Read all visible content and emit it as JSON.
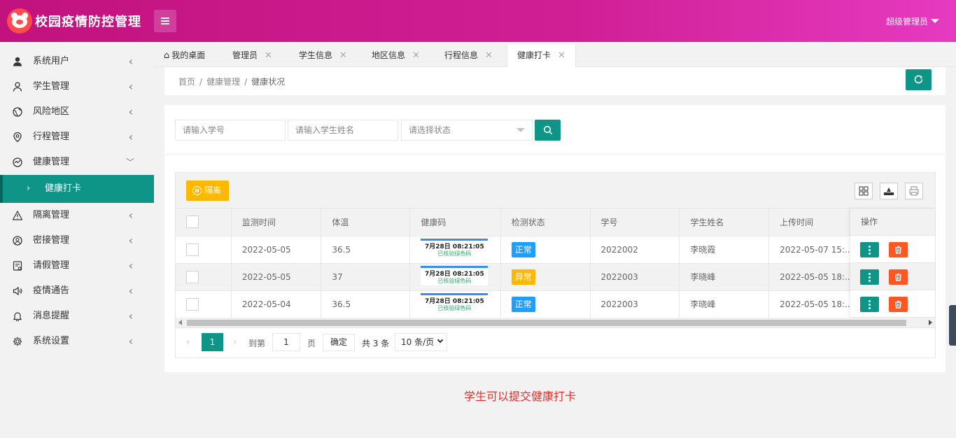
{
  "header": {
    "app_title": "校园疫情防控管理",
    "user_name": "超级管理员"
  },
  "sidebar": {
    "items": [
      {
        "label": "系统用户",
        "icon": "user-icon"
      },
      {
        "label": "学生管理",
        "icon": "user-outline-icon"
      },
      {
        "label": "风险地区",
        "icon": "globe-icon"
      },
      {
        "label": "行程管理",
        "icon": "location-icon"
      },
      {
        "label": "健康管理",
        "icon": "chart-icon",
        "expanded": true
      },
      {
        "label": "隔离管理",
        "icon": "warning-icon"
      },
      {
        "label": "密接管理",
        "icon": "contact-icon"
      },
      {
        "label": "请假管理",
        "icon": "form-icon"
      },
      {
        "label": "疫情通告",
        "icon": "speaker-icon"
      },
      {
        "label": "消息提醒",
        "icon": "bell-icon"
      },
      {
        "label": "系统设置",
        "icon": "gear-icon"
      }
    ],
    "sub_item": {
      "label": "健康打卡"
    }
  },
  "tabs": [
    {
      "label": "我的桌面",
      "icon": "home-icon"
    },
    {
      "label": "管理员"
    },
    {
      "label": "学生信息"
    },
    {
      "label": "地区信息"
    },
    {
      "label": "行程信息"
    },
    {
      "label": "健康打卡",
      "active": true
    }
  ],
  "breadcrumb": {
    "home": "首页",
    "sep": "/",
    "parent": "健康管理",
    "current": "健康状况"
  },
  "search": {
    "student_no_placeholder": "请输入学号",
    "student_name_placeholder": "请输入学生姓名",
    "status_placeholder": "请选择状态"
  },
  "toolbar": {
    "quarantine_label": "隔离"
  },
  "table": {
    "columns": [
      "监测时间",
      "体温",
      "健康码",
      "检测状态",
      "学号",
      "学生姓名",
      "上传时间",
      "操作"
    ],
    "rows": [
      {
        "date": "2022-05-05",
        "temp": "36.5",
        "code_time": "7月28日 08:21:05",
        "code_sub": "已核验绿色码",
        "status": "正常",
        "status_color": "#1e9fff",
        "student_no": "2022002",
        "name": "李晓霞",
        "upload": "2022-05-07 15:..."
      },
      {
        "date": "2022-05-05",
        "temp": "37",
        "code_time": "7月28日 08:21:05",
        "code_sub": "已核验绿色码",
        "status": "异常",
        "status_color": "#ffb800",
        "student_no": "2022003",
        "name": "李晓峰",
        "upload": "2022-05-05 18:..."
      },
      {
        "date": "2022-05-04",
        "temp": "36.5",
        "code_time": "7月28日 08:21:05",
        "code_sub": "已核验绿色码",
        "status": "正常",
        "status_color": "#1e9fff",
        "student_no": "2022003",
        "name": "李晓峰",
        "upload": "2022-05-05 18:..."
      }
    ]
  },
  "pager": {
    "current": "1",
    "goto_label": "到第",
    "goto_value": "1",
    "page_unit": "页",
    "ok_label": "确定",
    "total": "共 3 条",
    "page_size": "10 条/页"
  },
  "notice": "学生可以提交健康打卡",
  "colors": {
    "primary": "#0f9587",
    "warning": "#ffb800",
    "danger": "#ff5722",
    "info": "#1e9fff",
    "header": "#c2127e"
  }
}
